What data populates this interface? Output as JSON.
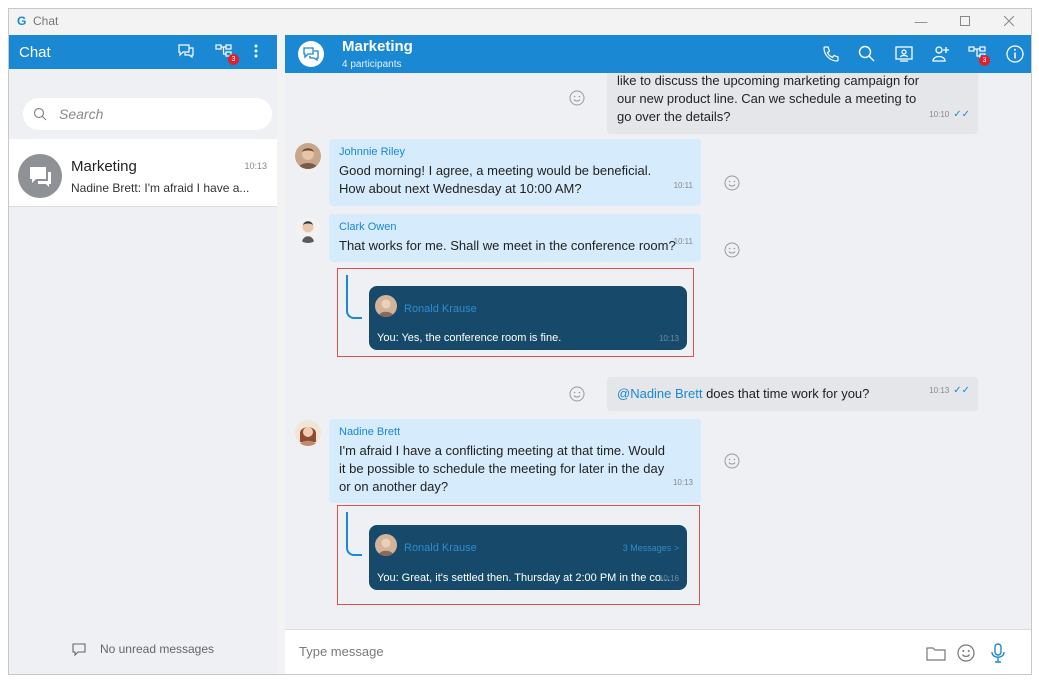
{
  "window": {
    "title": "Chat",
    "logo": "G"
  },
  "sidebar": {
    "title": "Chat",
    "badge_count": "3",
    "search_placeholder": "Search",
    "conversations": [
      {
        "name": "Marketing",
        "time": "10:13",
        "preview": "Nadine Brett: I'm afraid I have a..."
      }
    ],
    "no_unread": "No unread messages"
  },
  "chat": {
    "title": "Marketing",
    "participants": "4 participants",
    "badge_count": "3",
    "messages": [
      {
        "direction": "out",
        "lines": [
          "like to discuss the upcoming marketing campaign for",
          "our new product line. Can we schedule a meeting to",
          "go over the details?"
        ],
        "time": "10:10"
      },
      {
        "direction": "in",
        "sender": "Johnnie Riley",
        "lines": [
          "Good morning! I agree, a meeting would be beneficial.",
          "How about next Wednesday at 10:00 AM?"
        ],
        "time": "10:11"
      },
      {
        "direction": "in",
        "sender": "Clark Owen",
        "lines": [
          "That works for me. Shall we meet in the conference room?"
        ],
        "time": "10:11"
      },
      {
        "direction": "out",
        "mention": "@Nadine Brett",
        "text": " does that time work for you?",
        "time": "10:13"
      },
      {
        "direction": "in",
        "sender": "Nadine Brett",
        "lines": [
          "I'm afraid I have a conflicting meeting at that time. Would",
          "it be possible to schedule the meeting for later in the day",
          "or on another day?"
        ],
        "time": "10:13"
      }
    ],
    "threads": [
      {
        "name": "Ronald Krause",
        "text": "You: Yes, the conference room is fine.",
        "time": "10:13",
        "count": ""
      },
      {
        "name": "Ronald Krause",
        "text": "You: Great, it's settled then. Thursday at 2:00 PM in the co...",
        "time": "10:16",
        "count": "3 Messages >"
      }
    ],
    "compose_placeholder": "Type message"
  },
  "colors": {
    "accent": "#1a88d2",
    "incoming_bubble": "#d6ebfb",
    "outgoing_bubble": "#e4e6ea",
    "thread_card": "#174a6a",
    "badge": "#e0202a"
  }
}
